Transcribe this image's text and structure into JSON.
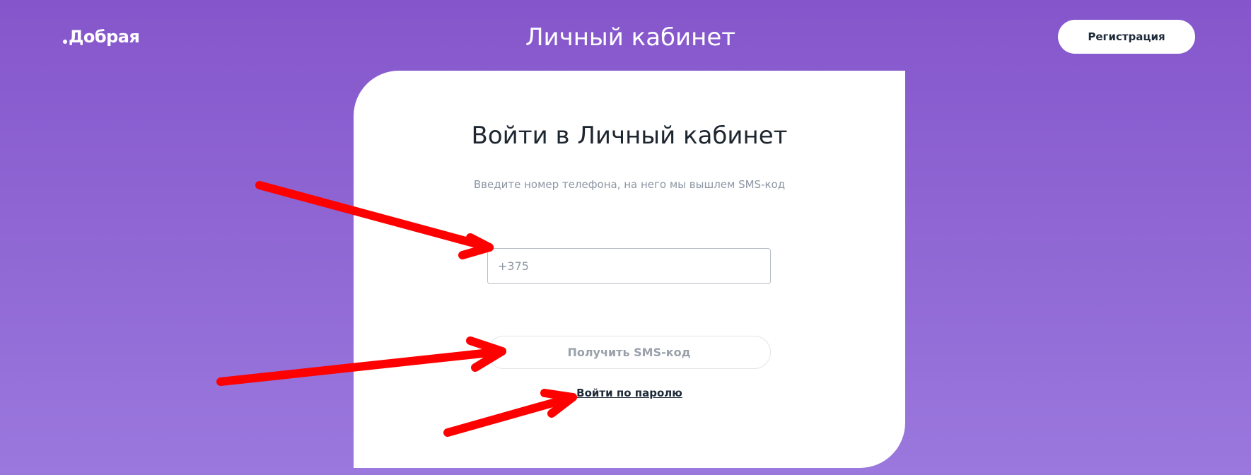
{
  "header": {
    "logo_text": "Добрая",
    "title": "Личный кабинет",
    "register_label": "Регистрация"
  },
  "login_card": {
    "title": "Войти в Личный кабинет",
    "subtitle": "Введите номер телефона, на него мы вышлем SMS-код",
    "phone_placeholder": "+375",
    "phone_value": "",
    "sms_button_label": "Получить SMS-код",
    "password_link_label": "Войти по паролю"
  },
  "annotations": {
    "arrow_color": "#ff0000"
  },
  "colors": {
    "background_top": "#8556cb",
    "background_bottom": "#9a78dd",
    "card": "#ffffff"
  }
}
